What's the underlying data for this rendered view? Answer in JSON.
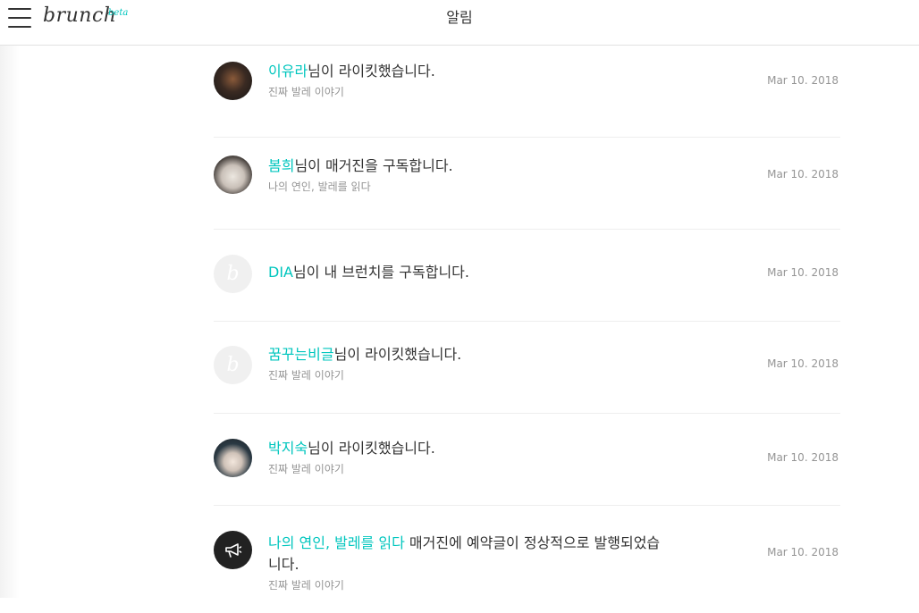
{
  "header": {
    "logo_text": "brunch",
    "logo_beta": "beta",
    "title": "알림"
  },
  "notifications": [
    {
      "avatar": "photo",
      "name": "이유라",
      "action": "님이 라이킷했습니다.",
      "sub": "진짜 발레 이야기",
      "date": "Mar 10. 2018"
    },
    {
      "avatar": "photo",
      "name": "봄희",
      "action": "님이 매거진을 구독합니다.",
      "sub": "나의 연인, 발레를 읽다",
      "date": "Mar 10. 2018"
    },
    {
      "avatar": "default",
      "name": "DIA",
      "action": "님이 내 브런치를 구독합니다.",
      "sub": "",
      "date": "Mar 10. 2018"
    },
    {
      "avatar": "default",
      "name": "꿈꾸는비글",
      "action": "님이 라이킷했습니다.",
      "sub": "진짜 발레 이야기",
      "date": "Mar 10. 2018"
    },
    {
      "avatar": "photo",
      "name": "박지숙",
      "action": "님이 라이킷했습니다.",
      "sub": "진짜 발레 이야기",
      "date": "Mar 10. 2018"
    },
    {
      "avatar": "megaphone-icon",
      "name": "나의 연인, 발레를 읽다",
      "action": " 매거진에 예약글이 정상적으로 발행되었습니다.",
      "sub": "진짜 발레 이야기",
      "date": "Mar 10. 2018"
    }
  ],
  "default_avatar_glyph": "b",
  "colors": {
    "accent": "#00c6be",
    "text": "#333333",
    "muted": "#959595",
    "divider": "#eeeeee"
  }
}
